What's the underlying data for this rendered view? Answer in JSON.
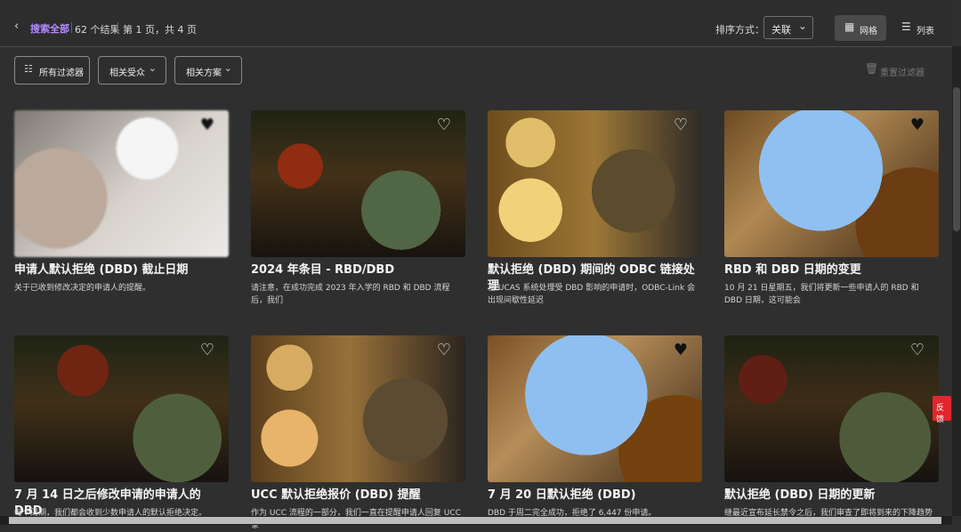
{
  "header": {
    "back_symbol": "‹",
    "back_label": "搜索全部",
    "results": "62 个结果",
    "page_info": "第 1 页，共 4 页",
    "sort_label": "排序方式：",
    "sort_value": "关联",
    "grid_label": "网格",
    "list_label": "列表"
  },
  "filters": {
    "all_filters": "所有过滤器",
    "audience": "相关受众",
    "plans": "相关方案",
    "reset": "重置过滤器"
  },
  "cards": [
    {
      "title": "申请人默认拒绝 (DBD) 截止日期",
      "description": "关于已收到修改决定的申请人的提醒。",
      "favorite": true
    },
    {
      "title": "2024 年条目 - RBD/DBD",
      "description": "请注意，在成功完成 2023 年入学的 RBD 和 DBD 流程后，我们",
      "favorite": false
    },
    {
      "title": "默认拒绝 (DBD) 期间的 ODBC 链接处理",
      "description": "当 UCAS 系统处理受 DBD 影响的申请时，ODBC-Link 会出现间歇性延迟",
      "favorite": false
    },
    {
      "title": "RBD 和 DBD 日期的变更",
      "description": "10 月 21 日星期五，我们将更新一些申请人的 RBD 和 DBD 日期，这可能会",
      "favorite": true
    },
    {
      "title": "7 月 14 日之后修改申请的申请人的 DBD",
      "description": "每个周期，我们都会收到少数申请人的默认拒绝决定。",
      "favorite": false
    },
    {
      "title": "UCC 默认拒绝报价 (DBD) 提醒",
      "description": "作为 UCC 流程的一部分，我们一直在提醒申请人回复 UCC 录",
      "favorite": false
    },
    {
      "title": "7 月 20 日默认拒绝 (DBD)",
      "description": "DBD 于周二完全成功，拒绝了 6,447 份申请。",
      "favorite": true
    },
    {
      "title": "默认拒绝 (DBD) 日期的更新",
      "description": "继最近宣布延长禁令之后，我们审查了即将到来的下降趋势",
      "favorite": false
    }
  ],
  "side_tab": "反馈",
  "colors": {
    "background": "#2f2f2f",
    "accent": "#b28cff",
    "feedback": "#e1262d"
  },
  "icons": {
    "back": "chevron-left-icon",
    "grid": "grid-icon",
    "list": "list-icon",
    "filters": "sliders-icon",
    "reset": "trash-icon",
    "favorite": "heart-icon"
  }
}
